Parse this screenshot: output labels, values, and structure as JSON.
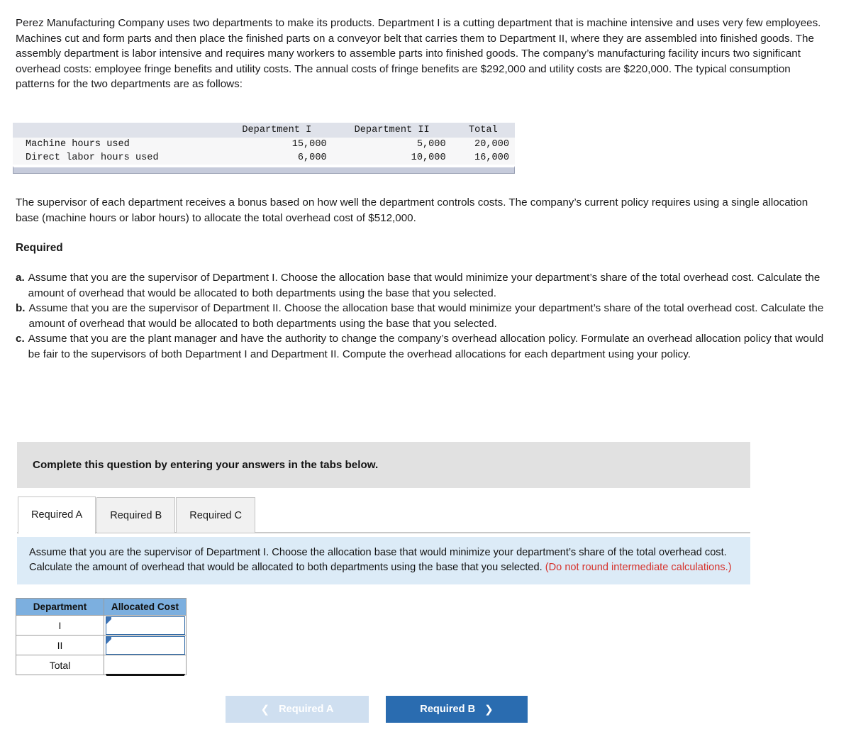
{
  "problem": {
    "paragraph": "Perez Manufacturing Company uses two departments to make its products. Department I is a cutting department that is machine intensive and uses very few employees. Machines cut and form parts and then place the finished parts on a conveyor belt that carries them to Department II, where they are assembled into finished goods. The assembly department is labor intensive and requires many workers to assemble parts into finished goods. The company’s manufacturing facility incurs two significant overhead costs: employee fringe benefits and utility costs. The annual costs of fringe benefits are $292,000 and utility costs are $220,000. The typical consumption patterns for the two departments are as follows:",
    "policy_paragraph": "The supervisor of each department receives a bonus based on how well the department controls costs. The company’s current policy requires using a single allocation base (machine hours or labor hours) to allocate the total overhead cost of $512,000."
  },
  "consumption_table": {
    "headers": [
      "",
      "Department I",
      "Department II",
      "Total"
    ],
    "rows": [
      {
        "label": "Machine hours used",
        "dept1": "15,000",
        "dept2": "5,000",
        "total": "20,000"
      },
      {
        "label": "Direct labor hours used",
        "dept1": "6,000",
        "dept2": "10,000",
        "total": "16,000"
      }
    ]
  },
  "required": {
    "heading": "Required",
    "items": [
      {
        "marker": "a.",
        "text": "Assume that you are the supervisor of Department I. Choose the allocation base that would minimize your department’s share of the total overhead cost. Calculate the amount of overhead that would be allocated to both departments using the base that you selected."
      },
      {
        "marker": "b.",
        "text": "Assume that you are the supervisor of Department II. Choose the allocation base that would minimize your department’s share of the total overhead cost. Calculate the amount of overhead that would be allocated to both departments using the base that you selected."
      },
      {
        "marker": "c.",
        "text": "Assume that you are the plant manager and have the authority to change the company’s overhead allocation policy. Formulate an overhead allocation policy that would be fair to the supervisors of both Department I and Department II. Compute the overhead allocations for each department using your policy."
      }
    ]
  },
  "banner": {
    "text": "Complete this question by entering your answers in the tabs below."
  },
  "tabs": [
    {
      "label": "Required A",
      "active": true
    },
    {
      "label": "Required B",
      "active": false
    },
    {
      "label": "Required C",
      "active": false
    }
  ],
  "instruction": {
    "main": "Assume that you are the supervisor of Department I. Choose the allocation base that would minimize your department’s share of the total overhead cost. Calculate the amount of overhead that would be allocated to both departments using the base that you selected.",
    "note": "(Do not round intermediate calculations.)"
  },
  "answer_table": {
    "headers": {
      "department": "Department",
      "allocated_cost": "Allocated Cost"
    },
    "rows": [
      {
        "department": "I",
        "allocated_cost": ""
      },
      {
        "department": "II",
        "allocated_cost": ""
      },
      {
        "department": "Total",
        "allocated_cost": ""
      }
    ]
  },
  "navigation": {
    "prev_label": "Required A",
    "prev_icon": "chevron-left-icon",
    "next_label": "Required B",
    "next_icon": "chevron-right-icon"
  },
  "colors": {
    "banner_bg": "#e1e1e1",
    "instruction_bg": "#dcebf7",
    "note_red": "#d6312b",
    "table_header_blue": "#7cafdf",
    "input_border_blue": "#2f6aa8",
    "btn_next_blue": "#2a6cb0",
    "btn_prev_blue": "#cfdff0"
  }
}
